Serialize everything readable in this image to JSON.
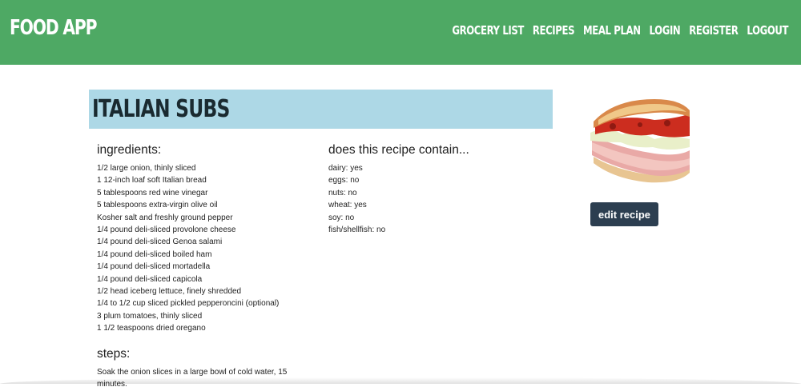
{
  "navbar": {
    "brand": "FOOD APP",
    "links": [
      "GROCERY LIST",
      "RECIPES",
      "MEAL PLAN",
      "LOGIN",
      "REGISTER",
      "LOGOUT"
    ]
  },
  "recipe": {
    "title": "ITALIAN SUBS",
    "ingredients_heading": "ingredients:",
    "ingredients": [
      "1/2 large onion, thinly sliced",
      "1 12-inch loaf soft Italian bread",
      "5 tablespoons red wine vinegar",
      "5 tablespoons extra-virgin olive oil",
      "Kosher salt and freshly ground pepper",
      "1/4 pound deli-sliced provolone cheese",
      "1/4 pound deli-sliced Genoa salami",
      "1/4 pound deli-sliced boiled ham",
      "1/4 pound deli-sliced mortadella",
      "1/4 pound deli-sliced capicola",
      "1/2 head iceberg lettuce, finely shredded",
      "1/4 to 1/2 cup sliced pickled pepperoncini (optional)",
      "3 plum tomatoes, thinly sliced",
      "1 1/2 teaspoons dried oregano"
    ],
    "contains_heading": "does this recipe contain...",
    "allergens": [
      "dairy: yes",
      "eggs: no",
      "nuts: no",
      "wheat: yes",
      "soy: no",
      "fish/shellfish: no"
    ],
    "steps_heading": "steps:",
    "steps": [
      "Soak the onion slices in a large bowl of cold water, 15 minutes."
    ],
    "image_icon": "sandwich-photo",
    "edit_label": "edit recipe"
  },
  "colors": {
    "navbar": "#4ea964",
    "title_bar": "#add8e6",
    "button": "#2c3e50"
  }
}
